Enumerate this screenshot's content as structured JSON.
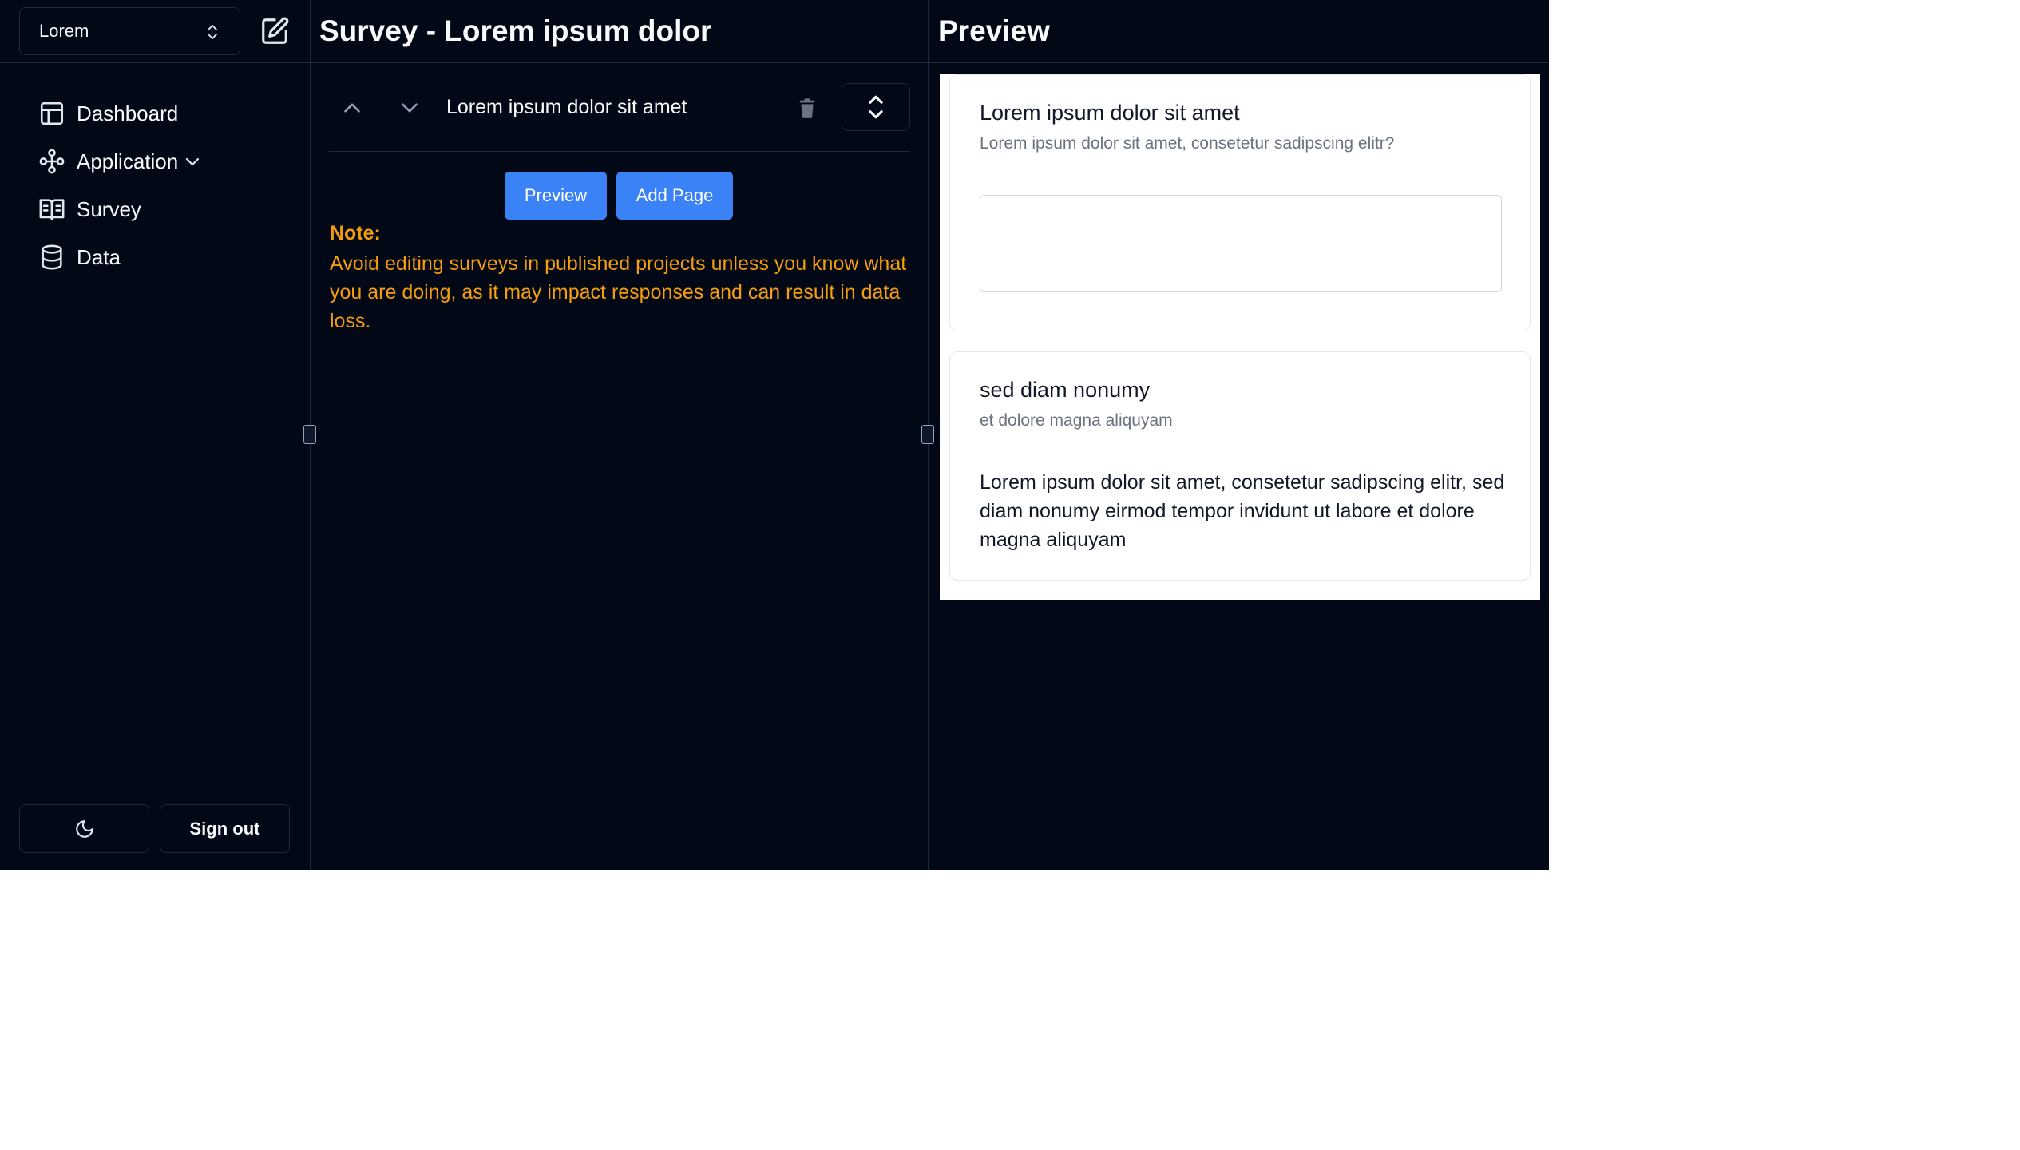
{
  "sidebar": {
    "project_name": "Lorem",
    "nav": [
      {
        "label": "Dashboard",
        "icon": "layout-icon"
      },
      {
        "label": "Application",
        "icon": "workflow-icon"
      },
      {
        "label": "Survey",
        "icon": "book-open-icon"
      },
      {
        "label": "Data",
        "icon": "database-icon"
      }
    ],
    "theme_toggle_icon": "moon-icon",
    "sign_out_label": "Sign out"
  },
  "editor": {
    "title": "Survey - Lorem ipsum dolor",
    "question_title": "Lorem ipsum dolor sit amet",
    "preview_label": "Preview",
    "add_page_label": "Add Page",
    "note_label": "Note:",
    "note_text": "Avoid editing surveys in published projects unless you know what you are doing, as it may impact responses and can result in data loss."
  },
  "preview": {
    "title": "Preview",
    "cards": [
      {
        "title": "Lorem ipsum dolor sit amet",
        "description": "Lorem ipsum dolor sit amet, consetetur sadipscing elitr?",
        "answer_value": ""
      },
      {
        "title": "sed diam nonumy",
        "description": "et dolore magna aliquyam",
        "body": "Lorem ipsum dolor sit amet, consetetur sadipscing elitr, sed diam nonumy eirmod tempor invidunt ut labore et dolore magna aliquyam"
      }
    ]
  },
  "colors": {
    "background": "#030817",
    "border": "#1e293b",
    "primary": "#3b82f6",
    "warning": "#f59e0b"
  }
}
